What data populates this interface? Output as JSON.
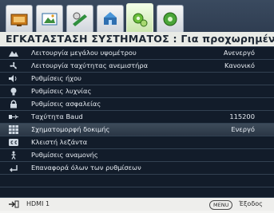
{
  "tabs": [
    {
      "icon": "display-icon",
      "active": false
    },
    {
      "icon": "image-picture-icon",
      "active": false
    },
    {
      "icon": "settings-icon",
      "active": false
    },
    {
      "icon": "install-icon",
      "active": false
    },
    {
      "icon": "system-setup-icon",
      "active": true
    },
    {
      "icon": "info-icon",
      "active": false
    }
  ],
  "title": "ΕΓΚΑΤΑΣΤΑΣΗ ΣΥΣΤΗΜΑΤΟΣ : Για προχωρημένους",
  "items": [
    {
      "icon": "high-altitude-icon",
      "label": "Λειτουργία μεγάλου υψομέτρου",
      "value": "Ανενεργό"
    },
    {
      "icon": "fan-icon",
      "label": "Λειτουργία ταχύτητας ανεμιστήρα",
      "value": "Κανονικό"
    },
    {
      "icon": "speaker-icon",
      "label": "Ρυθμίσεις ήχου",
      "value": ""
    },
    {
      "icon": "lamp-icon",
      "label": "Ρυθμίσεις λυχνίας",
      "value": ""
    },
    {
      "icon": "lock-icon",
      "label": "Ρυθμίσεις ασφαλείας",
      "value": ""
    },
    {
      "icon": "baud-rate-icon",
      "label": "Ταχύτητα Baud",
      "value": "115200"
    },
    {
      "icon": "test-pattern-icon",
      "label": "Σχηματομορφή δοκιμής",
      "value": "Ενεργό",
      "selected": true
    },
    {
      "icon": "closed-caption-icon",
      "label": "Κλειστή λεζάντα",
      "value": ""
    },
    {
      "icon": "standby-icon",
      "label": "Ρυθμίσεις αναμονής",
      "value": ""
    },
    {
      "icon": "reset-icon",
      "label": "Επαναφορά όλων των ρυθμίσεων",
      "value": ""
    },
    {
      "icon": "",
      "label": "",
      "value": ""
    },
    {
      "icon": "",
      "label": "",
      "value": ""
    }
  ],
  "status": {
    "source": "HDMI 1",
    "menu_key": "MENU",
    "exit": "Έξοδος"
  },
  "colors": {
    "list_bg": "#121c2a",
    "header_bg": "#2d3b4f",
    "active_tab": "#c7e3a8",
    "selected_row": "#3a4756"
  }
}
